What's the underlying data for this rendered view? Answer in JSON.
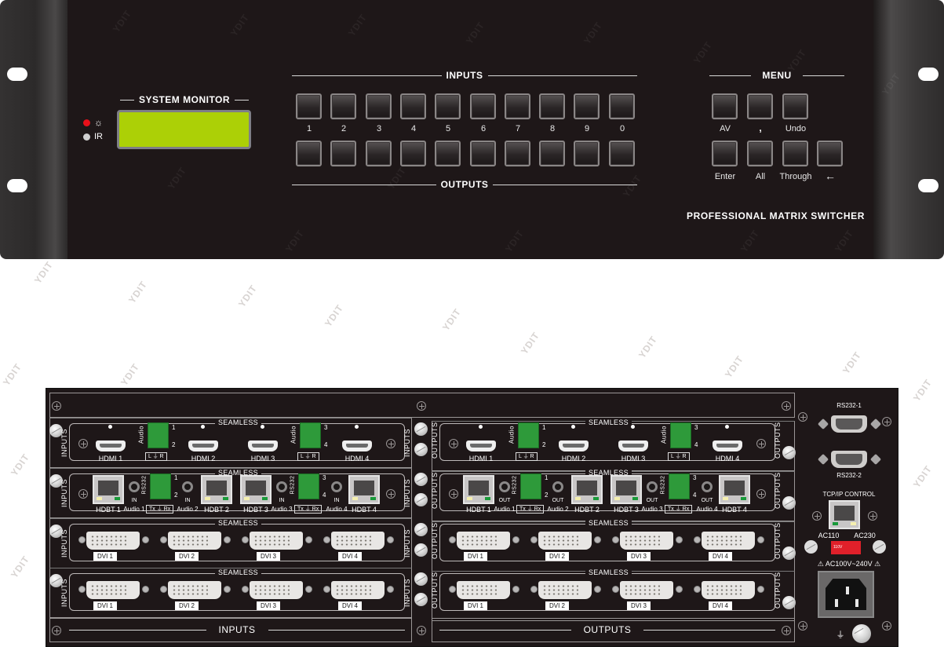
{
  "watermark": "YDIT",
  "front_panel": {
    "indicators": [
      {
        "name": "power",
        "icon": "sun-icon",
        "color": "#e8101a"
      },
      {
        "name": "ir",
        "label": "IR",
        "icon": "ir-receiver-icon"
      }
    ],
    "system_monitor": {
      "title": "SYSTEM MONITOR",
      "lcd_color": "#acd006",
      "lcd_text": ""
    },
    "inputs_title": "INPUTS",
    "outputs_title": "OUTPUTS",
    "number_keys": [
      "1",
      "2",
      "3",
      "4",
      "5",
      "6",
      "7",
      "8",
      "9",
      "0"
    ],
    "menu": {
      "title": "MENU",
      "row1": [
        "AV",
        ",",
        "Undo"
      ],
      "row2": [
        "Enter",
        "All",
        "Through",
        "←"
      ]
    },
    "brand": "PROFESSIONAL MATRIX SWITCHER"
  },
  "rear_panel": {
    "card_title": "SEAMLESS",
    "input_side": "INPUTS",
    "output_side": "OUTPUTS",
    "hdmi_labels": [
      "HDMI 1",
      "HDMI 2",
      "HDMI 3",
      "HDMI 4"
    ],
    "audio_block": {
      "label": "Audio",
      "caption": "L ⏚ R",
      "nums_a": [
        "1",
        "2"
      ],
      "nums_b": [
        "3",
        "4"
      ]
    },
    "hdbt_labels": [
      "HDBT 1",
      "HDBT 2",
      "HDBT 3",
      "HDBT 4"
    ],
    "rs232_block": {
      "label": "RS232",
      "caption": "Tx ⏚ Rx"
    },
    "in_audio": {
      "dir": "IN",
      "labels": [
        "Audio 1",
        "Audio 2",
        "Audio 3",
        "Audio 4"
      ]
    },
    "out_audio": {
      "dir": "OUT",
      "labels": [
        "Audio 1",
        "Audio 2",
        "Audio 3",
        "Audio 4"
      ]
    },
    "dvi_labels": [
      "DVI 1",
      "DVI 2",
      "DVI 3",
      "DVI 4"
    ],
    "bottom_inputs": "INPUTS",
    "bottom_outputs": "OUTPUTS",
    "control": {
      "rs232_1": "RS232-1",
      "rs232_2": "RS232-2",
      "tcpip": "TCP/IP CONTROL",
      "ac110": "AC110",
      "ac230": "AC230",
      "switch_text": "110V",
      "switch_color": "#e0202a",
      "power_rating": "⚠ AC100V~240V ⚠"
    }
  }
}
